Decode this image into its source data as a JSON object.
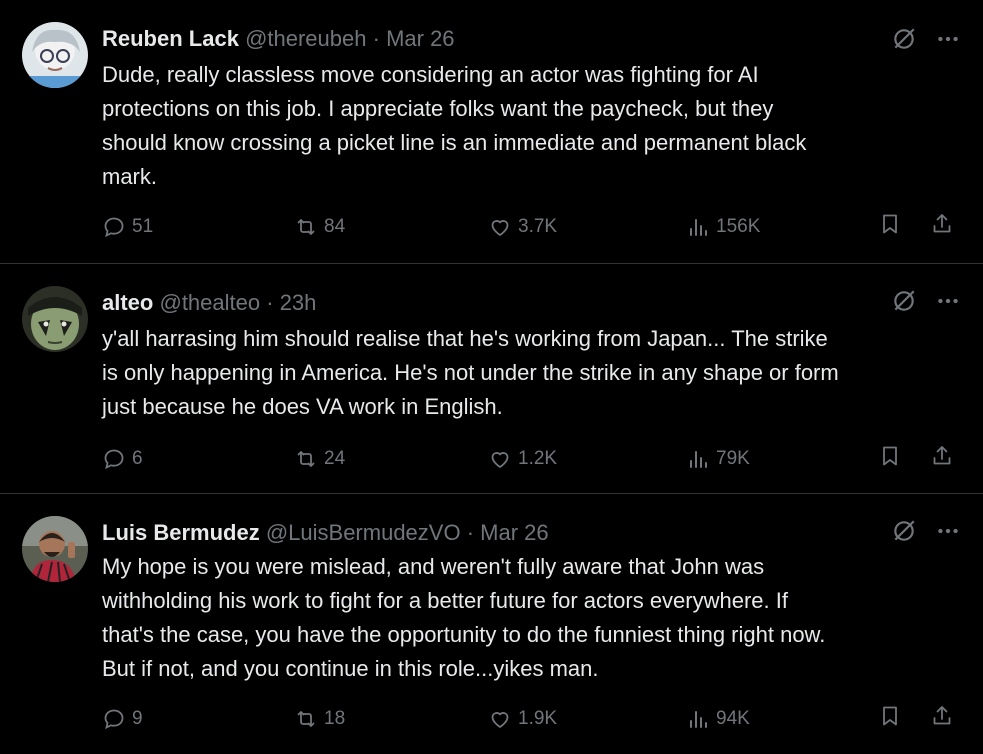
{
  "tweets": [
    {
      "name": "Reuben Lack",
      "handle": "@thereubeh",
      "sep": "·",
      "time": "Mar 26",
      "text": "Dude, really classless move considering an actor was fighting for AI\nprotections on this job. I appreciate folks want the paycheck, but they\nshould know crossing a picket line is an immediate and permanent black\nmark.",
      "replies": "51",
      "reposts": "84",
      "likes": "3.7K",
      "views": "156K"
    },
    {
      "name": "alteo",
      "handle": "@thealteo",
      "sep": "·",
      "time": "23h",
      "text": "y'all harrasing him should realise that he's working from Japan... The strike\nis only happening in America. He's not under the strike in any shape or form\njust because he does VA work in English.",
      "replies": "6",
      "reposts": "24",
      "likes": "1.2K",
      "views": "79K"
    },
    {
      "name": "Luis Bermudez",
      "handle": "@LuisBermudezVO",
      "sep": "·",
      "time": "Mar 26",
      "text": "My hope is you were mislead, and weren't fully aware that John was\nwithholding his work to fight for a better future for actors everywhere. If\nthat's the case, you have the opportunity to do the funniest thing right now.\nBut if not, and you continue in this role...yikes man.",
      "replies": "9",
      "reposts": "18",
      "likes": "1.9K",
      "views": "94K"
    }
  ],
  "icons": {
    "reply": "speech-bubble-icon",
    "repost": "repost-arrows-icon",
    "like": "heart-icon",
    "views": "bar-chart-icon",
    "bookmark": "bookmark-icon",
    "share": "share-upload-icon",
    "grok": "grok-slash-circle-icon",
    "more": "more-dots-icon"
  },
  "colors": {
    "background": "#000000",
    "text": "#e7e9ea",
    "muted": "#71767b",
    "divider": "#2f3336"
  }
}
